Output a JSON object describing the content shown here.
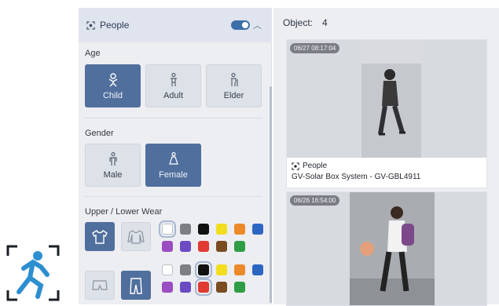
{
  "filter": {
    "header_label": "People",
    "toggle_on": true,
    "age": {
      "label": "Age",
      "options": [
        {
          "label": "Child",
          "selected": true,
          "icon": "child-icon"
        },
        {
          "label": "Adult",
          "selected": false,
          "icon": "adult-icon"
        },
        {
          "label": "Elder",
          "selected": false,
          "icon": "elder-icon"
        }
      ]
    },
    "gender": {
      "label": "Gender",
      "options": [
        {
          "label": "Male",
          "selected": false,
          "icon": "male-icon"
        },
        {
          "label": "Female",
          "selected": true,
          "icon": "female-icon"
        }
      ]
    },
    "wear": {
      "label": "Upper / Lower Wear",
      "upper_colors": [
        "#ffffff",
        "#7d7f84",
        "#111111",
        "#f2de1e",
        "#ec8a2a",
        "#2d66c2",
        "#9b4dc2",
        "#6b4bc3",
        "#e03a32",
        "#7a4c21",
        "#2f9d45"
      ],
      "lower_colors": [
        "#ffffff",
        "#7d7f84",
        "#111111",
        "#f2de1e",
        "#ec8a2a",
        "#2d66c2",
        "#9b4dc2",
        "#6b4bc3",
        "#e03a32",
        "#7a4c21",
        "#2f9d45"
      ],
      "upper_selected": 0,
      "lower_selected": [
        2,
        8
      ]
    }
  },
  "results": {
    "object_label": "Object:",
    "object_count": "4",
    "cards": [
      {
        "time": "06/27 08:17:04",
        "type": "People",
        "source": "GV-Solar Box System - GV-GBL4911"
      },
      {
        "time": "06/26 16:54:00",
        "type": "",
        "source": ""
      }
    ]
  },
  "colors": {
    "accent": "#506f9d",
    "panel": "#edeef1",
    "run_icon": "#2d8fd0"
  }
}
